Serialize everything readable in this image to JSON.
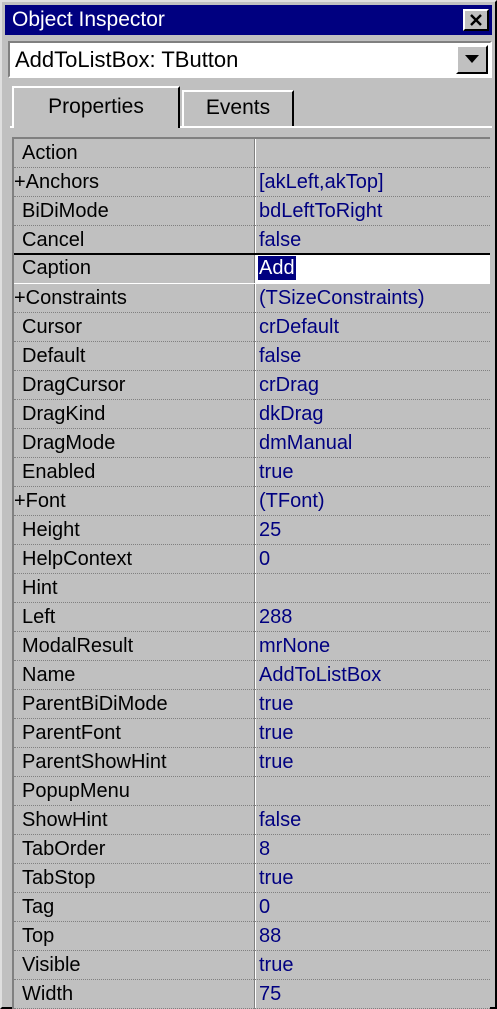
{
  "window": {
    "title": "Object Inspector"
  },
  "combo": {
    "selected": "AddToListBox: TButton"
  },
  "tabs": [
    {
      "label": "Properties",
      "active": true
    },
    {
      "label": "Events",
      "active": false
    }
  ],
  "properties": [
    {
      "name": "Action",
      "value": ""
    },
    {
      "name": "+Anchors",
      "value": "[akLeft,akTop]"
    },
    {
      "name": "BiDiMode",
      "value": "bdLeftToRight"
    },
    {
      "name": "Cancel",
      "value": "false"
    },
    {
      "name": "Caption",
      "value": "Add",
      "selected": true
    },
    {
      "name": "+Constraints",
      "value": "(TSizeConstraints)"
    },
    {
      "name": "Cursor",
      "value": "crDefault"
    },
    {
      "name": "Default",
      "value": "false"
    },
    {
      "name": "DragCursor",
      "value": "crDrag"
    },
    {
      "name": "DragKind",
      "value": "dkDrag"
    },
    {
      "name": "DragMode",
      "value": "dmManual"
    },
    {
      "name": "Enabled",
      "value": "true"
    },
    {
      "name": "+Font",
      "value": "(TFont)"
    },
    {
      "name": "Height",
      "value": "25"
    },
    {
      "name": "HelpContext",
      "value": "0"
    },
    {
      "name": "Hint",
      "value": ""
    },
    {
      "name": "Left",
      "value": "288"
    },
    {
      "name": "ModalResult",
      "value": "mrNone"
    },
    {
      "name": "Name",
      "value": "AddToListBox"
    },
    {
      "name": "ParentBiDiMode",
      "value": "true"
    },
    {
      "name": "ParentFont",
      "value": "true"
    },
    {
      "name": "ParentShowHint",
      "value": "true"
    },
    {
      "name": "PopupMenu",
      "value": ""
    },
    {
      "name": "ShowHint",
      "value": "false"
    },
    {
      "name": "TabOrder",
      "value": "8"
    },
    {
      "name": "TabStop",
      "value": "true"
    },
    {
      "name": "Tag",
      "value": "0"
    },
    {
      "name": "Top",
      "value": "88"
    },
    {
      "name": "Visible",
      "value": "true"
    },
    {
      "name": "Width",
      "value": "75"
    }
  ],
  "colors": {
    "titlebar": "#000080",
    "face": "#c0c0c0",
    "value_text": "#000080"
  }
}
